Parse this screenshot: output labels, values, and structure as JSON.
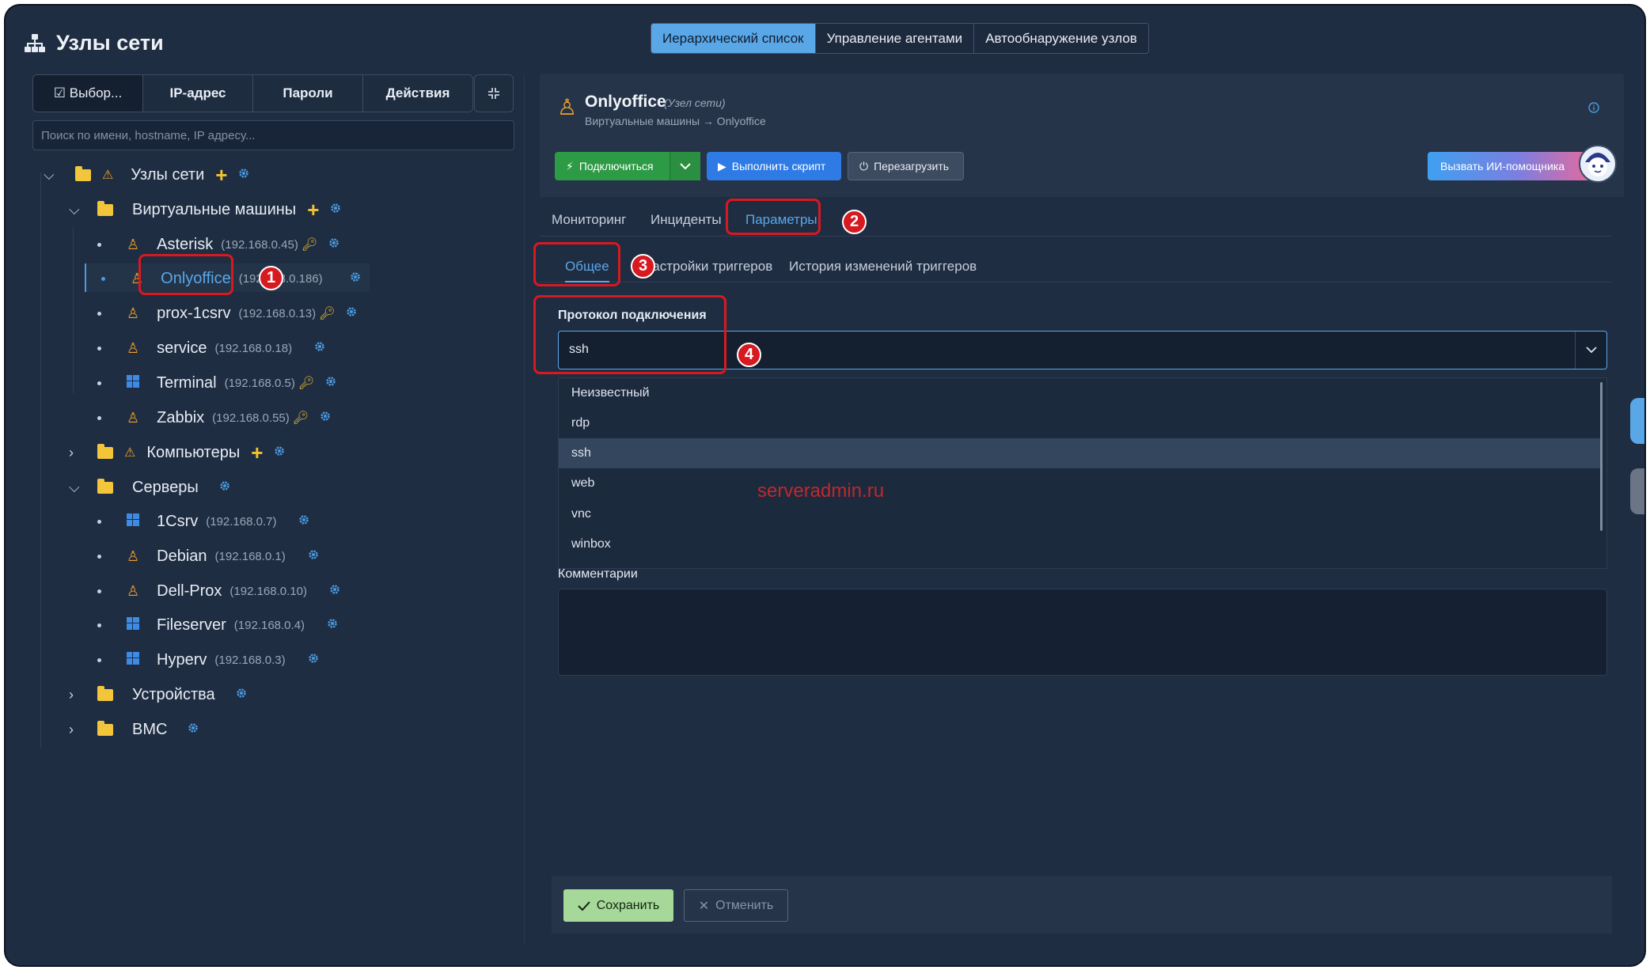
{
  "app": {
    "title": "Узлы сети"
  },
  "top_tabs": [
    "Иерархический список",
    "Управление агентами",
    "Автообнаружение узлов"
  ],
  "left": {
    "segments": [
      "☑ Выбор...",
      "IP-адрес",
      "Пароли",
      "Действия"
    ],
    "search_placeholder": "Поиск по имени, hostname, IP адресу...",
    "root": "Узлы сети",
    "tree": [
      {
        "label": "Виртуальные машины"
      },
      {
        "label": "Asterisk",
        "ip": "(192.168.0.45)"
      },
      {
        "label": "Onlyoffice",
        "ip": "(192.168.0.186)"
      },
      {
        "label": "prox-1csrv",
        "ip": "(192.168.0.13)"
      },
      {
        "label": "service",
        "ip": "(192.168.0.18)"
      },
      {
        "label": "Terminal",
        "ip": "(192.168.0.5)"
      },
      {
        "label": "Zabbix",
        "ip": "(192.168.0.55)"
      },
      {
        "label": "Компьютеры"
      },
      {
        "label": "Серверы"
      },
      {
        "label": "1Csrv",
        "ip": "(192.168.0.7)"
      },
      {
        "label": "Debian",
        "ip": "(192.168.0.1)"
      },
      {
        "label": "Dell-Prox",
        "ip": "(192.168.0.10)"
      },
      {
        "label": "Fileserver",
        "ip": "(192.168.0.4)"
      },
      {
        "label": "Hyperv",
        "ip": "(192.168.0.3)"
      },
      {
        "label": "Устройства"
      },
      {
        "label": "BMC"
      }
    ]
  },
  "node": {
    "name": "Onlyoffice",
    "type": "(Узел сети)",
    "path": "Виртуальные машины → Onlyoffice",
    "connect_label": "Подключиться",
    "script_label": "Выполнить скрипт",
    "reboot_label": "Перезагрузить",
    "ai_label": "Вызвать ИИ-помощника"
  },
  "tabs": [
    "Мониторинг",
    "Инциденты",
    "Параметры"
  ],
  "subtabs": [
    "Общее",
    "Настройки триггеров",
    "История изменений триггеров"
  ],
  "form": {
    "protocol_label": "Протокол подключения",
    "protocol_value": "ssh",
    "options": [
      "Неизвестный",
      "rdp",
      "ssh",
      "web",
      "vnc",
      "winbox"
    ],
    "comments_label": "Комментарии",
    "save_label": "Сохранить",
    "cancel_label": "Отменить"
  },
  "watermark": "serveradmin.ru",
  "badges": [
    "1",
    "2",
    "3",
    "4"
  ],
  "colors": {
    "accent": "#5aa7e8",
    "annotation": "#d71920",
    "connect": "#2d9b46",
    "save": "#a6d89a"
  }
}
